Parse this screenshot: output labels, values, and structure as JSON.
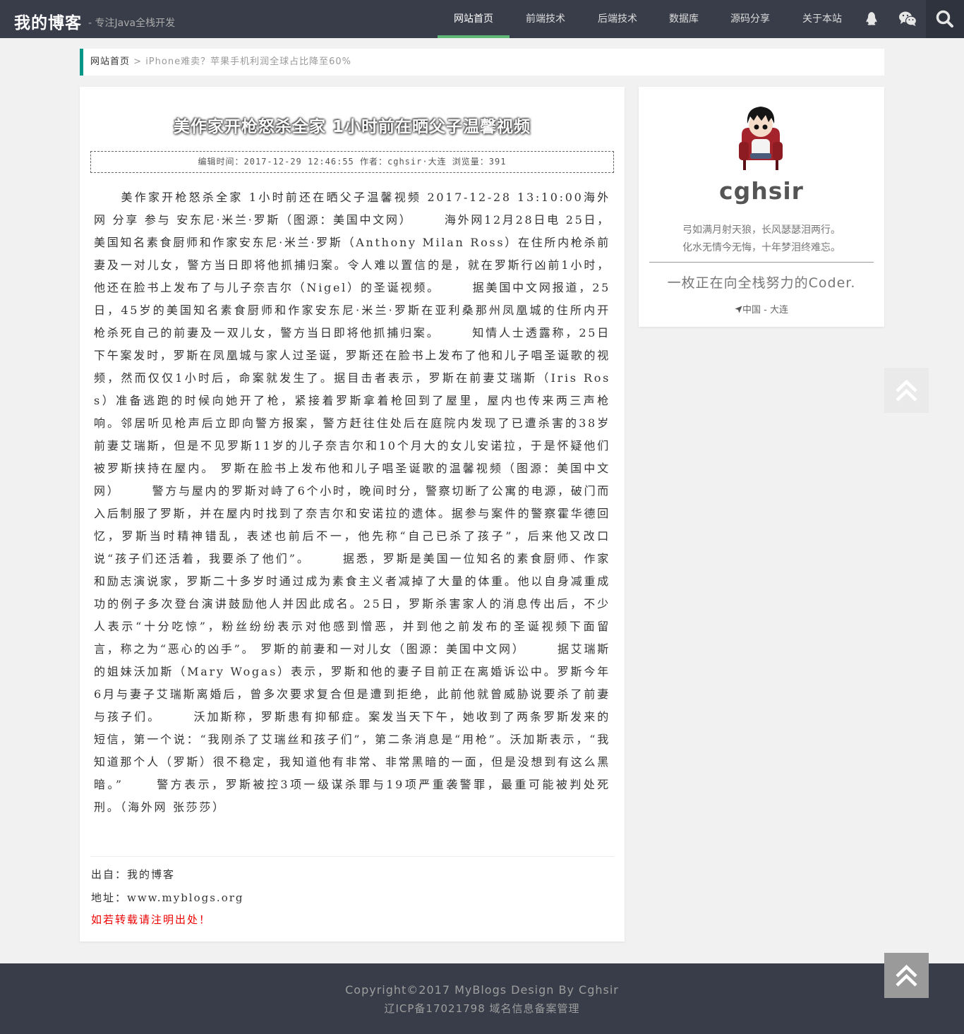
{
  "header": {
    "logo": "我的博客",
    "slogan": "- 专注Java全栈开发",
    "nav": [
      {
        "label": "网站首页",
        "active": true
      },
      {
        "label": "前端技术",
        "active": false
      },
      {
        "label": "后端技术",
        "active": false
      },
      {
        "label": "数据库",
        "active": false
      },
      {
        "label": "源码分享",
        "active": false
      },
      {
        "label": "关于本站",
        "active": false
      }
    ],
    "icons": [
      "qq-icon",
      "wechat-icon",
      "search-icon"
    ]
  },
  "breadcrumb": {
    "home": "网站首页",
    "separator": " > ",
    "current": "iPhone难卖？苹果手机利润全球占比降至60%"
  },
  "article": {
    "title": "美作家开枪怒杀全家 1小时前在晒父子温馨视频",
    "meta": "编辑时间：2017-12-29 12:46:55 作者：cghsir·大连 浏览量：391",
    "body": "　　美作家开枪怒杀全家 1小时前还在晒父子温馨视频 2017-12-28 13:10:00海外网 分享 参与 安东尼·米兰·罗斯（图源：美国中文网） 　　海外网12月28日电 25日，美国知名素食厨师和作家安东尼·米兰·罗斯（Anthony Milan Ross）在住所内枪杀前妻及一对儿女，警方当日即将他抓捕归案。令人难以置信的是，就在罗斯行凶前1小时，他还在脸书上发布了与儿子奈吉尔（Nigel）的圣诞视频。 　　据美国中文网报道，25日，45岁的美国知名素食厨师和作家安东尼·米兰·罗斯在亚利桑那州凤凰城的住所内开枪杀死自己的前妻及一双儿女，警方当日即将他抓捕归案。 　　知情人士透露称，25日下午案发时，罗斯在凤凰城与家人过圣诞，罗斯还在脸书上发布了他和儿子唱圣诞歌的视频，然而仅仅1小时后，命案就发生了。据目击者表示，罗斯在前妻艾瑞斯（Iris Ross）准备逃跑的时候向她开了枪，紧接着罗斯拿着枪回到了屋里，屋内也传来两三声枪响。邻居听见枪声后立即向警方报案，警方赶往住处后在庭院内发现了已遭杀害的38岁前妻艾瑞斯，但是不见罗斯11岁的儿子奈吉尔和10个月大的女儿安诺拉，于是怀疑他们被罗斯挟持在屋内。 罗斯在脸书上发布他和儿子唱圣诞歌的温馨视频（图源：美国中文网） 　　警方与屋内的罗斯对峙了6个小时，晚间时分，警察切断了公寓的电源，破门而入后制服了罗斯，并在屋内时找到了奈吉尔和安诺拉的遗体。据参与案件的警察霍华德回忆，罗斯当时精神错乱，表述也前后不一，他先称“自己已杀了孩子”，后来他又改口说“孩子们还活着，我要杀了他们”。 　　据悉，罗斯是美国一位知名的素食厨师、作家和励志演说家，罗斯二十多岁时通过成为素食主义者减掉了大量的体重。他以自身减重成功的例子多次登台演讲鼓励他人并因此成名。25日，罗斯杀害家人的消息传出后，不少人表示“十分吃惊”，粉丝纷纷表示对他感到憎恶，并到他之前发布的圣诞视频下面留言，称之为“恶心的凶手”。 罗斯的前妻和一对儿女（图源：美国中文网） 　　据艾瑞斯的姐妹沃加斯（Mary Wogas）表示，罗斯和他的妻子目前正在离婚诉讼中。罗斯今年6月与妻子艾瑞斯离婚后，曾多次要求复合但是遭到拒绝，此前他就曾威胁说要杀了前妻与孩子们。 　　沃加斯称，罗斯患有抑郁症。案发当天下午，她收到了两条罗斯发来的短信，第一个说：“我刚杀了艾瑞丝和孩子们”，第二条消息是“用枪”。沃加斯表示，“我知道那个人（罗斯）很不稳定，我知道他有非常、非常黑暗的一面，但是没想到有这么黑暗。” 　　警方表示，罗斯被控3项一级谋杀罪与19项严重袭警罪，最重可能被判处死刑。（海外网 张莎莎）",
    "source": "出自：我的博客",
    "address": "地址：www.myblogs.org",
    "notice": "如若转载请注明出处！"
  },
  "profile": {
    "name": "cghsir",
    "motto1": "弓如满月射天狼，长风瑟瑟泪两行。",
    "motto2": "化水无情今无悔，十年梦泪终难忘。",
    "tagline": "一枚正在向全栈努力的Coder.",
    "location": "中国 - 大连"
  },
  "footer": {
    "copyright": "Copyright©2017 MyBlogs Design By Cghsir",
    "icp": "辽ICP备17021798 域名信息备案管理"
  },
  "colors": {
    "header_bg": "#393d49",
    "accent": "#5fb878",
    "breadcrumb_border": "#009688",
    "notice": "#ee0000"
  }
}
